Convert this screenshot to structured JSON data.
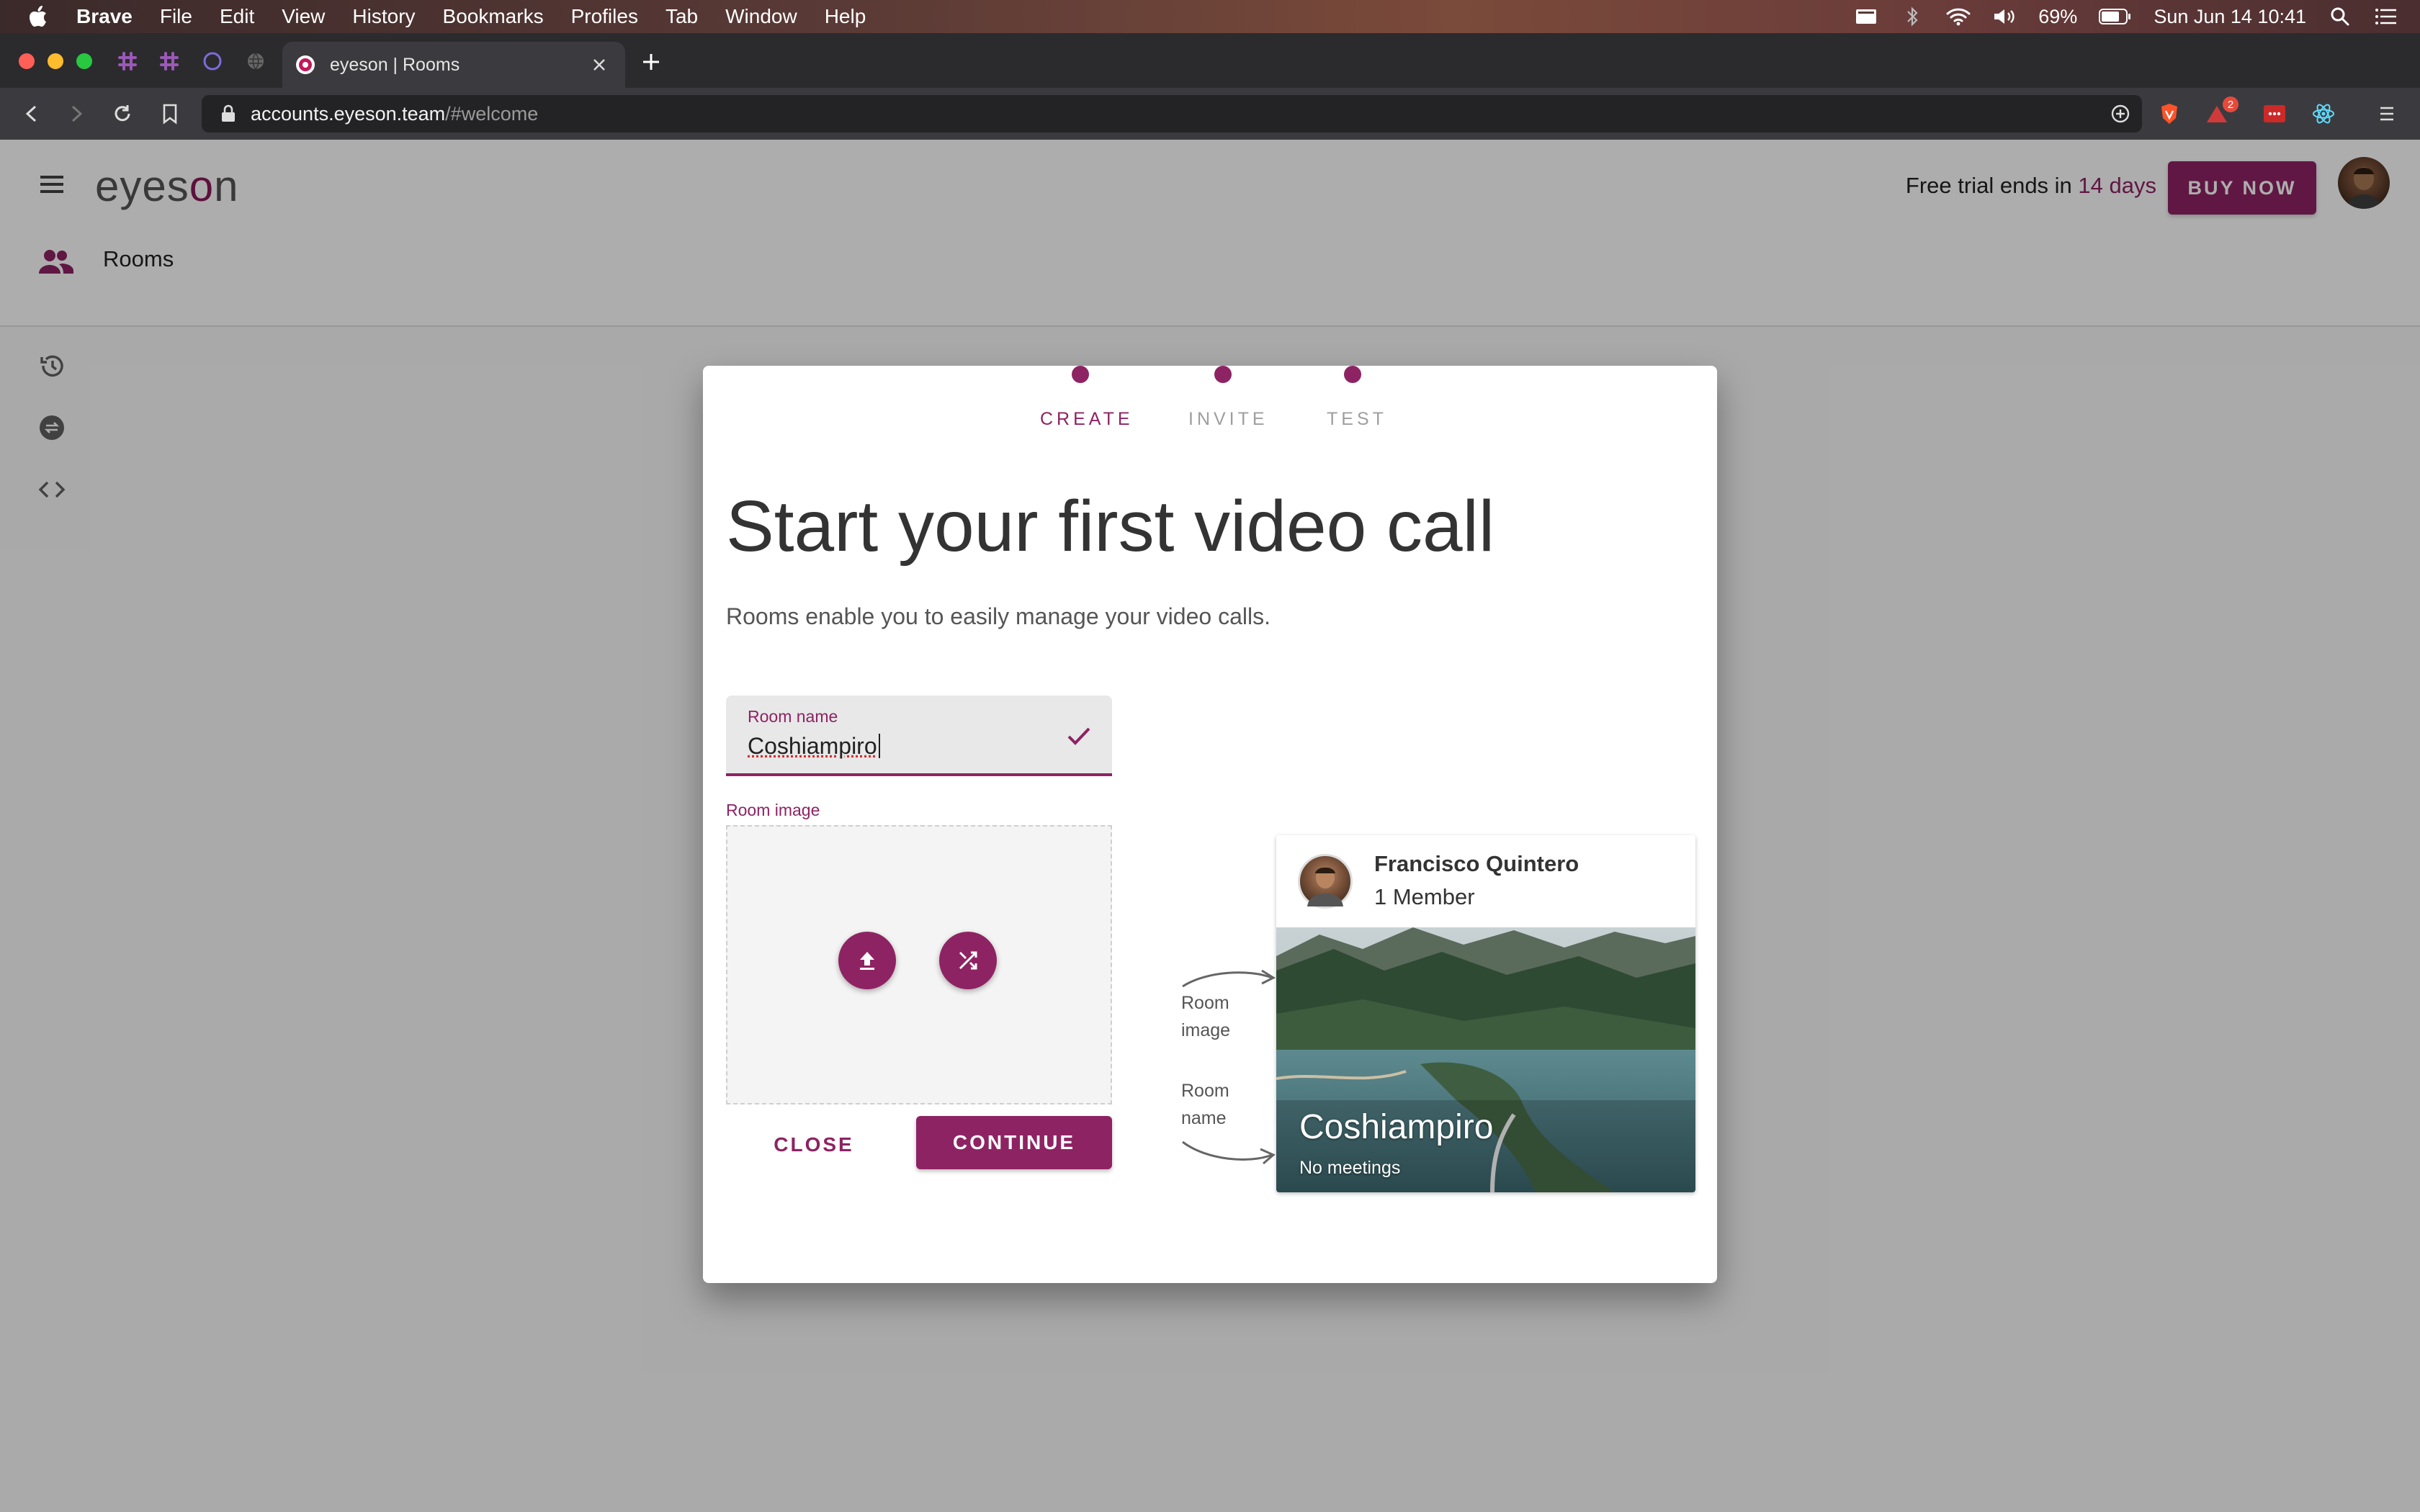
{
  "menubar": {
    "app": "Brave",
    "items": [
      "File",
      "Edit",
      "View",
      "History",
      "Bookmarks",
      "Profiles",
      "Tab",
      "Window",
      "Help"
    ],
    "battery": "69%",
    "datetime": "Sun Jun 14  10:41"
  },
  "browser": {
    "tab_title": "eyeson | Rooms",
    "url_host": "accounts.eyeson.team",
    "url_path": "/#welcome",
    "badge_count": "2"
  },
  "app": {
    "logo_prefix": "eyes",
    "logo_o": "o",
    "logo_suffix": "n",
    "nav_rooms": "Rooms",
    "trial_prefix": "Free trial ends in ",
    "trial_days": "14 days",
    "buy_now": "BUY NOW"
  },
  "dialog": {
    "steps": [
      "CREATE",
      "INVITE",
      "TEST"
    ],
    "active_step": "CREATE",
    "title": "Start your first video call",
    "subtitle": "Rooms enable you to easily manage your video calls.",
    "room_name_label": "Room name",
    "room_name_value": "Coshiampiro",
    "room_image_label": "Room image",
    "close_label": "CLOSE",
    "continue_label": "CONTINUE",
    "annotation_image": [
      "Room",
      "image"
    ],
    "annotation_name": [
      "Room",
      "name"
    ]
  },
  "preview": {
    "owner": "Francisco Quintero",
    "members": "1 Member",
    "room_name": "Coshiampiro",
    "meetings": "No meetings"
  },
  "colors": {
    "accent": "#8e2363",
    "menubar": "#5a3a36"
  },
  "icons": [
    "apple-icon",
    "slack-icon",
    "loader-icon",
    "globe-icon",
    "close-icon",
    "plus-icon",
    "back-icon",
    "forward-icon",
    "reload-icon",
    "bookmark-icon",
    "lock-icon",
    "add-circle-icon",
    "brave-shield-icon",
    "brave-rewards-icon",
    "lastpass-icon",
    "react-icon",
    "menu-icon",
    "hamburger-icon",
    "people-icon",
    "history-icon",
    "sync-icon",
    "code-icon",
    "check-icon",
    "upload-icon",
    "shuffle-icon"
  ]
}
